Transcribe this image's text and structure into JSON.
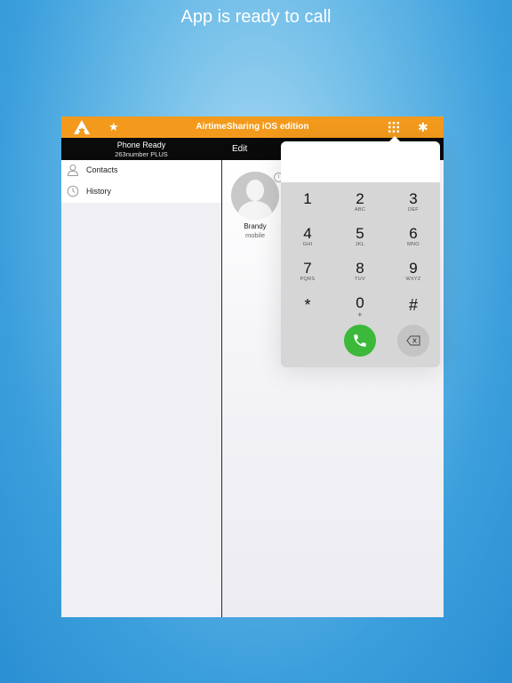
{
  "caption": "App is ready to call",
  "topbar": {
    "title": "AirtimeSharing iOS edition",
    "logo_icon": "airtimesharing-logo-icon",
    "favorites_icon": "star-icon",
    "keypad_icon": "keypad-grid-icon",
    "settings_icon": "gear-icon",
    "star_glyph": "★",
    "gear_glyph": "✱",
    "color": "#f39a1c"
  },
  "status": {
    "title": "Phone Ready",
    "number": "263number PLUS",
    "edit_label": "Edit"
  },
  "sidebar": {
    "items": [
      {
        "label": "Contacts",
        "icon": "person-icon"
      },
      {
        "label": "History",
        "icon": "clock-icon"
      }
    ]
  },
  "contacts": [
    {
      "name": "Brandy",
      "type": "mobile",
      "info_glyph": "i"
    }
  ],
  "dialpad": {
    "keys": [
      {
        "digit": "1",
        "letters": ""
      },
      {
        "digit": "2",
        "letters": "ABC"
      },
      {
        "digit": "3",
        "letters": "DEF"
      },
      {
        "digit": "4",
        "letters": "GHI"
      },
      {
        "digit": "5",
        "letters": "JKL"
      },
      {
        "digit": "6",
        "letters": "MNO"
      },
      {
        "digit": "7",
        "letters": "PQRS"
      },
      {
        "digit": "8",
        "letters": "TUV"
      },
      {
        "digit": "9",
        "letters": "WXYZ"
      },
      {
        "digit": "*",
        "letters": ""
      },
      {
        "digit": "0",
        "letters": "+"
      },
      {
        "digit": "#",
        "letters": ""
      }
    ],
    "call_icon": "phone-icon",
    "backspace_icon": "backspace-icon",
    "call_color": "#3cb83a"
  }
}
